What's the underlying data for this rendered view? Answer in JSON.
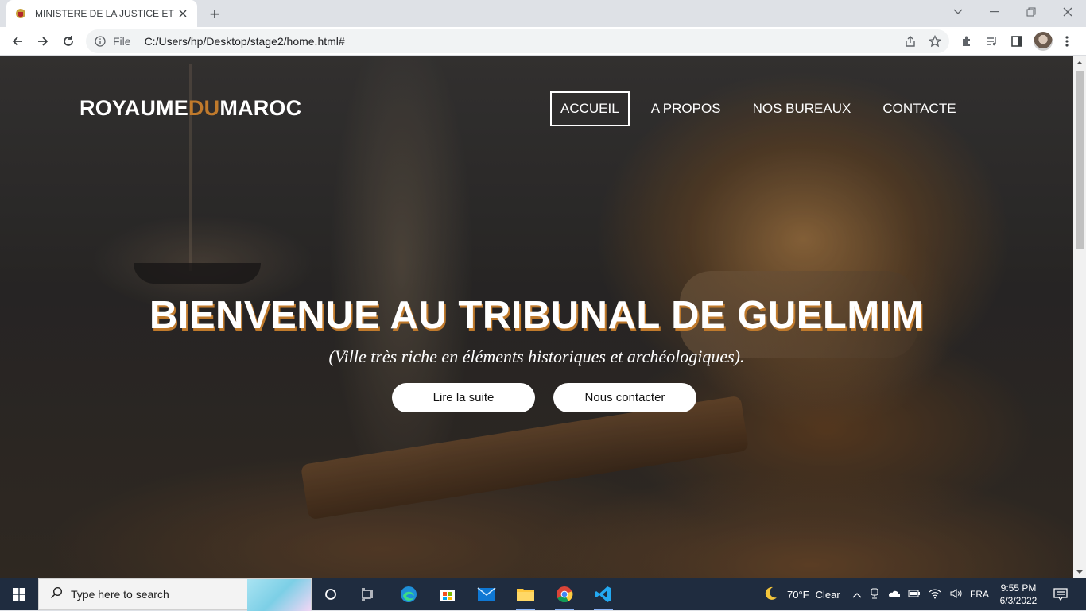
{
  "browser": {
    "tab_title": "MINISTERE DE LA JUSTICE ET DE",
    "new_tab_symbol": "+",
    "scheme_label": "File",
    "url": "C:/Users/hp/Desktop/stage2/home.html#"
  },
  "page": {
    "brand": {
      "part1": "ROYAUME",
      "part2": "DU",
      "part3": "MAROC"
    },
    "nav": [
      "ACCUEIL",
      "A PROPOS",
      "NOS BUREAUX",
      "CONTACTE"
    ],
    "hero": {
      "title": "BIENVENUE AU TRIBUNAL DE GUELMIM",
      "subtitle": "(Ville très riche en éléments historiques et archéologiques).",
      "buttons": [
        "Lire la suite",
        "Nous contacter"
      ]
    },
    "accent_color": "#c07a2c"
  },
  "taskbar": {
    "search_placeholder": "Type here to search",
    "weather_temp": "70°F",
    "weather_text": "Clear",
    "language": "FRA",
    "time": "9:55 PM",
    "date": "6/3/2022"
  }
}
